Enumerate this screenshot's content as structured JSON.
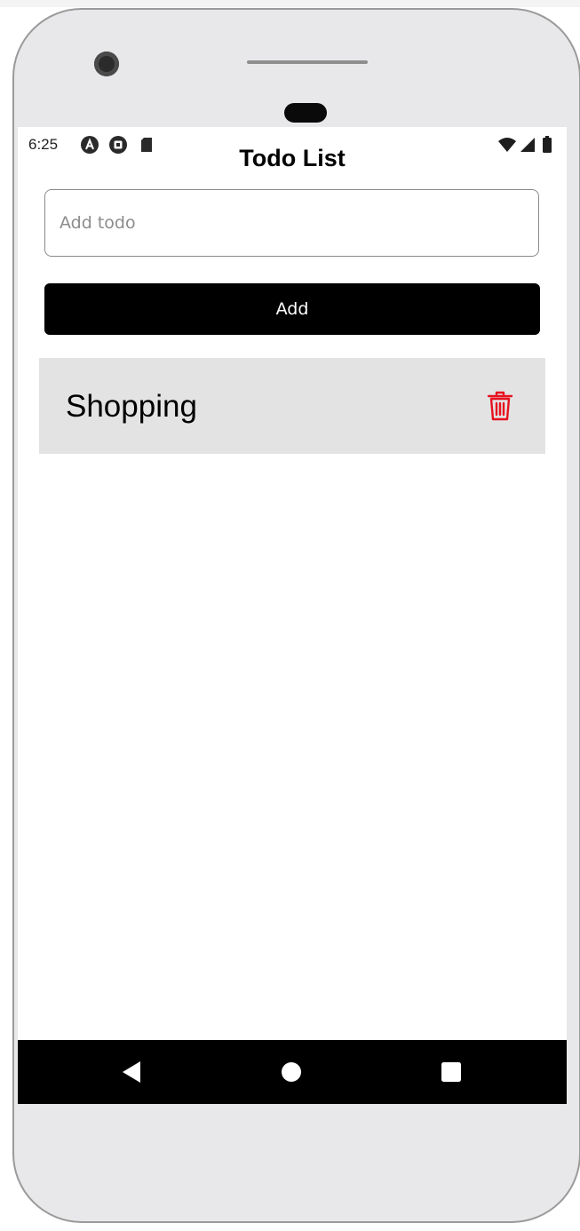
{
  "status_bar": {
    "time": "6:25",
    "icons": [
      "accessibility-icon",
      "assistant-icon",
      "sd-card-icon",
      "wifi-icon",
      "signal-icon",
      "battery-icon"
    ]
  },
  "app": {
    "title": "Todo List"
  },
  "input": {
    "placeholder": "Add todo",
    "value": ""
  },
  "add_button": {
    "label": "Add"
  },
  "todos": [
    {
      "text": "Shopping",
      "delete_icon": "trash-icon"
    }
  ],
  "navigation": {
    "buttons": [
      "back-icon",
      "home-icon",
      "recents-icon"
    ]
  },
  "colors": {
    "delete": "#e8121f",
    "button_bg": "#000000",
    "item_bg": "#e3e3e4"
  }
}
